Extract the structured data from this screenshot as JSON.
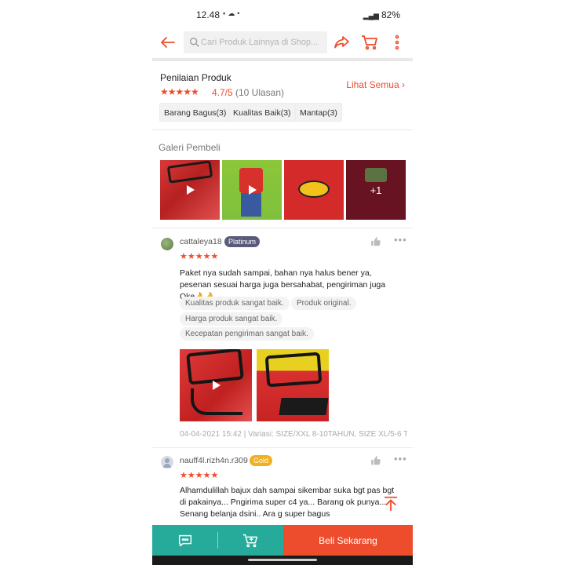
{
  "status_bar": {
    "time": "12.48",
    "battery": "82%",
    "dot": "•"
  },
  "header": {
    "search_placeholder": "Cari Produk Lainnya di Shop..."
  },
  "rating": {
    "title": "Penilaian Produk",
    "stars": "★★★★★",
    "score": "4.7/5",
    "count": "(10 Ulasan)",
    "see_all": "Lihat Semua",
    "chips": [
      "Barang Bagus(3)",
      "Kualitas Baik(3)",
      "Mantap(3)"
    ]
  },
  "gallery": {
    "title": "Galeri Pembeli",
    "more_label": "+1"
  },
  "reviews": [
    {
      "username": "cattaleya18",
      "tier": "Platinum",
      "stars": "★★★★★",
      "text": "Paket nya sudah sampai, bahan nya halus bener ya, pesenan sesuai harga juga bersahabat, pengiriman juga Oke👌👌",
      "tags": [
        "Kualitas produk sangat baik.",
        "Produk original.",
        "Harga produk sangat baik.",
        "Kecepatan pengiriman sangat baik."
      ],
      "meta": "04-04-2021 15:42 | Variasi: SIZE/XXL 8-10TAHUN, SIZE XL/5-6 T..."
    },
    {
      "username": "nauff4l.rizh4n.r309",
      "tier": "Gold",
      "stars": "★★★★★",
      "text": "Alhamdulillah  bajux dah sampai sikembar suka bgt pas bgt di pakainya... Pngirima  super c4 ya... Barang ok punya... Senang belanja dsini..  Ara g super bagus"
    }
  ],
  "bottom": {
    "buy_label": "Beli Sekarang"
  },
  "colors": {
    "accent": "#ee4d2d",
    "teal": "#26aa99",
    "platinum": "#5a5a7a",
    "gold": "#f0b020"
  },
  "icons": [
    "back-arrow-icon",
    "search-icon",
    "share-icon",
    "cart-icon",
    "more-vert-icon",
    "chevron-right-icon",
    "play-icon",
    "thumbs-up-icon",
    "more-horiz-icon",
    "chat-icon",
    "add-to-cart-icon",
    "scroll-top-icon"
  ]
}
